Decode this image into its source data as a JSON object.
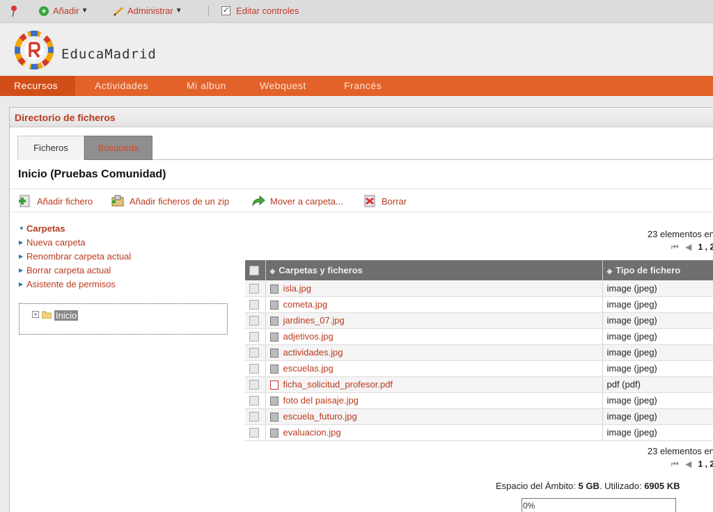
{
  "adminbar": {
    "add_label": "Añadir",
    "manage_label": "Administrar",
    "edit_controls_label": "Editar controles"
  },
  "header": {
    "brand": "EducaMadrid"
  },
  "nav": {
    "items": [
      {
        "label": "Recursos",
        "active": true
      },
      {
        "label": "Actividades",
        "active": false
      },
      {
        "label": "Mi albun",
        "active": false
      },
      {
        "label": "Webquest",
        "active": false
      },
      {
        "label": "Francés",
        "active": false
      }
    ]
  },
  "panel": {
    "title": "Directorio de ficheros",
    "tabs": [
      {
        "label": "Ficheros",
        "selected": true
      },
      {
        "label": "Búsqueda",
        "selected": false
      }
    ],
    "folder_title": "Inicio (Pruebas Comunidad)",
    "toolbar": {
      "add_file": "Añadir fichero",
      "add_zip": "Añadir ficheros de un zip",
      "move": "Mover a carpeta...",
      "delete": "Borrar"
    },
    "folders_menu": {
      "heading": "Carpetas",
      "items": [
        "Nueva carpeta",
        "Renombrar carpeta actual",
        "Borrar carpeta actual",
        "Asistente de permisos"
      ]
    },
    "tree": {
      "root_label": "Inicio"
    },
    "count_label": "23 elementos en",
    "pager_text": "1 , 2",
    "table": {
      "col_name": "Carpetas y ficheros",
      "col_type": "Tipo de fichero",
      "rows": [
        {
          "name": "isla.jpg",
          "type": "image (jpeg)",
          "kind": "img"
        },
        {
          "name": "cometa.jpg",
          "type": "image (jpeg)",
          "kind": "img"
        },
        {
          "name": "jardines_07.jpg",
          "type": "image (jpeg)",
          "kind": "img"
        },
        {
          "name": "adjetivos.jpg",
          "type": "image (jpeg)",
          "kind": "img"
        },
        {
          "name": "actividades.jpg",
          "type": "image (jpeg)",
          "kind": "img"
        },
        {
          "name": "escuelas.jpg",
          "type": "image (jpeg)",
          "kind": "img"
        },
        {
          "name": "ficha_solicitud_profesor.pdf",
          "type": "pdf (pdf)",
          "kind": "pdf"
        },
        {
          "name": "foto del paisaje.jpg",
          "type": "image (jpeg)",
          "kind": "img"
        },
        {
          "name": "escuela_futuro.jpg",
          "type": "image (jpeg)",
          "kind": "img"
        },
        {
          "name": "evaluacion.jpg",
          "type": "image (jpeg)",
          "kind": "img"
        }
      ]
    },
    "quota": {
      "prefix": "Espacio del Ámbito:",
      "size": "5 GB",
      "used_label": ". Utilizado:",
      "used": "6905 KB",
      "percent_text": "0%",
      "percent_value": 0
    }
  },
  "colors": {
    "accent_orange": "#e2622a",
    "link_red": "#b83a1d"
  }
}
